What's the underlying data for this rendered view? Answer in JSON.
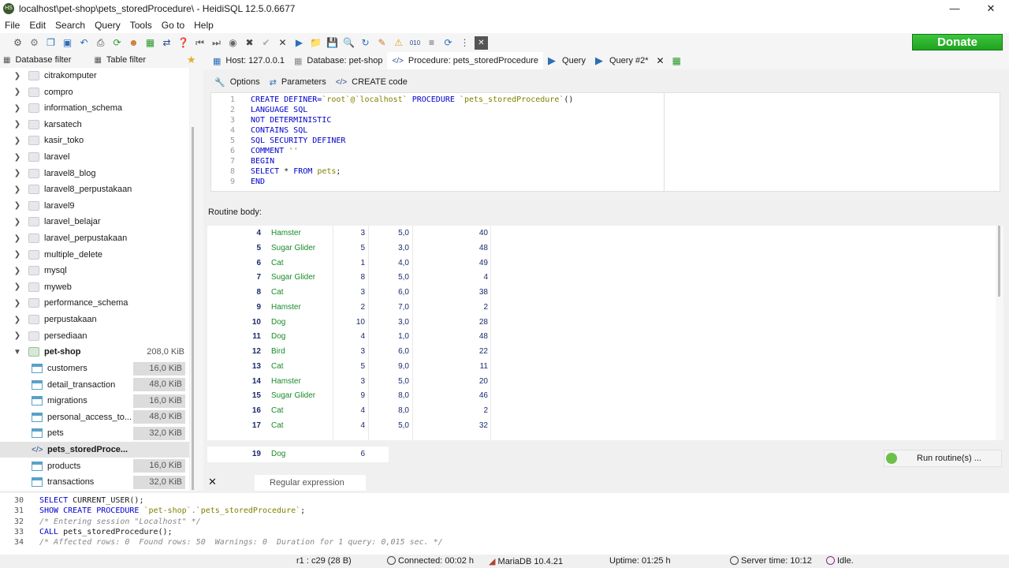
{
  "window": {
    "title": "localhost\\pet-shop\\pets_storedProcedure\\ - HeidiSQL 12.5.0.6677",
    "app_icon": "HS"
  },
  "menu": [
    "File",
    "Edit",
    "Search",
    "Query",
    "Tools",
    "Go to",
    "Help"
  ],
  "donate_label": "Donate",
  "filters": {
    "database": "Database filter",
    "table": "Table filter"
  },
  "tree": {
    "databases": [
      "citrakomputer",
      "compro",
      "information_schema",
      "karsatech",
      "kasir_toko",
      "laravel",
      "laravel8_blog",
      "laravel8_perpustakaan",
      "laravel9",
      "laravel_belajar",
      "laravel_perpustakaan",
      "multiple_delete",
      "mysql",
      "myweb",
      "performance_schema",
      "perpustakaan",
      "persediaan"
    ],
    "open_db": {
      "name": "pet-shop",
      "size": "208,0 KiB"
    },
    "tables": [
      {
        "name": "customers",
        "size": "16,0 KiB"
      },
      {
        "name": "detail_transaction",
        "size": "48,0 KiB"
      },
      {
        "name": "migrations",
        "size": "16,0 KiB"
      },
      {
        "name": "personal_access_to...",
        "size": "48,0 KiB"
      },
      {
        "name": "pets",
        "size": "32,0 KiB"
      },
      {
        "name": "pets_storedProce...",
        "size": ""
      },
      {
        "name": "products",
        "size": "16,0 KiB"
      },
      {
        "name": "transactions",
        "size": "32,0 KiB"
      }
    ]
  },
  "tabs": {
    "host": "Host: 127.0.0.1",
    "database": "Database: pet-shop",
    "procedure": "Procedure: pets_storedProcedure",
    "query": "Query",
    "query2": "Query #2*"
  },
  "subtabs": {
    "options": "Options",
    "parameters": "Parameters",
    "create_code": "CREATE code"
  },
  "code_lines": [
    {
      "n": "1",
      "parts": [
        [
          "kw",
          "CREATE DEFINER="
        ],
        [
          "str",
          "`root`@`localhost`"
        ],
        [
          "kw",
          " PROCEDURE "
        ],
        [
          "str",
          "`pets_storedProcedure`"
        ],
        [
          "",
          "()"
        ]
      ]
    },
    {
      "n": "2",
      "parts": [
        [
          "kw",
          "LANGUAGE SQL"
        ]
      ]
    },
    {
      "n": "3",
      "parts": [
        [
          "kw",
          "NOT DETERMINISTIC"
        ]
      ]
    },
    {
      "n": "4",
      "parts": [
        [
          "kw",
          "CONTAINS SQL"
        ]
      ]
    },
    {
      "n": "5",
      "parts": [
        [
          "kw",
          "SQL SECURITY DEFINER"
        ]
      ]
    },
    {
      "n": "6",
      "parts": [
        [
          "kw",
          "COMMENT "
        ],
        [
          "str",
          "''"
        ]
      ]
    },
    {
      "n": "7",
      "parts": [
        [
          "kw",
          "BEGIN"
        ]
      ]
    },
    {
      "n": "8",
      "parts": [
        [
          "kw",
          "SELECT"
        ],
        [
          "",
          " * "
        ],
        [
          "kw",
          "FROM"
        ],
        [
          "",
          " "
        ],
        [
          "str",
          "pets"
        ],
        [
          "",
          ";"
        ]
      ]
    },
    {
      "n": "9",
      "parts": [
        [
          "kw",
          "END"
        ]
      ]
    }
  ],
  "routine_body_label": "Routine body:",
  "rows": [
    [
      "4",
      "Hamster",
      "3",
      "5,0",
      "40"
    ],
    [
      "5",
      "Sugar Glider",
      "5",
      "3,0",
      "48"
    ],
    [
      "6",
      "Cat",
      "1",
      "4,0",
      "49"
    ],
    [
      "7",
      "Sugar Glider",
      "8",
      "5,0",
      "4"
    ],
    [
      "8",
      "Cat",
      "3",
      "6,0",
      "38"
    ],
    [
      "9",
      "Hamster",
      "2",
      "7,0",
      "2"
    ],
    [
      "10",
      "Dog",
      "10",
      "3,0",
      "28"
    ],
    [
      "11",
      "Dog",
      "4",
      "1,0",
      "48"
    ],
    [
      "12",
      "Bird",
      "3",
      "6,0",
      "22"
    ],
    [
      "13",
      "Cat",
      "5",
      "9,0",
      "11"
    ],
    [
      "14",
      "Hamster",
      "3",
      "5,0",
      "20"
    ],
    [
      "15",
      "Sugar Glider",
      "9",
      "8,0",
      "46"
    ],
    [
      "16",
      "Cat",
      "4",
      "8,0",
      "2"
    ],
    [
      "17",
      "Cat",
      "4",
      "5,0",
      "32"
    ]
  ],
  "partial_row": {
    "id": "19",
    "name": "Dog",
    "a": "6"
  },
  "run_routine": "Run routine(s) ...",
  "regex_placeholder": "Regular expression",
  "log": [
    {
      "n": "30",
      "parts": [
        [
          "kw",
          "SELECT "
        ],
        [
          "",
          "CURRENT_USER();"
        ]
      ]
    },
    {
      "n": "31",
      "parts": [
        [
          "kw",
          "SHOW CREATE PROCEDURE "
        ],
        [
          "str",
          "`pet-shop`.`pets_storedProcedure`"
        ],
        [
          "",
          ";"
        ]
      ]
    },
    {
      "n": "32",
      "parts": [
        [
          "cm",
          "/* Entering session \"Localhost\" */"
        ]
      ]
    },
    {
      "n": "33",
      "parts": [
        [
          "kw",
          "CALL "
        ],
        [
          "",
          "pets_storedProcedure();"
        ]
      ]
    },
    {
      "n": "34",
      "parts": [
        [
          "cm",
          "/* Affected rows: 0  Found rows: 50  Warnings: 0  Duration for 1 query: 0,015 sec. */"
        ]
      ]
    }
  ],
  "status": {
    "cursor": "r1 : c29 (28 B)",
    "connected": "Connected: 00:02 h",
    "server": "MariaDB 10.4.21",
    "uptime": "Uptime: 01:25 h",
    "server_time": "Server time: 10:12",
    "state": "Idle."
  }
}
